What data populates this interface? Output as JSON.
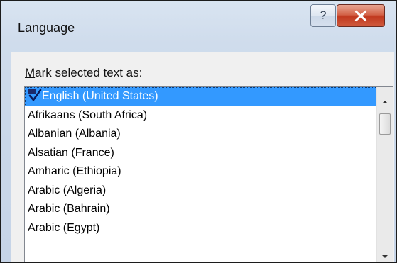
{
  "window": {
    "title": "Language",
    "help_glyph": "?",
    "help_icon": "help-icon",
    "close_icon": "close-icon",
    "close_color": "#c1391f"
  },
  "mark_label": {
    "accesskey": "M",
    "rest": "ark selected text as:"
  },
  "languages": {
    "selected_index": 0,
    "selected_icon": "spelling-abc-check-icon",
    "items": [
      "English (United States)",
      "Afrikaans (South Africa)",
      "Albanian (Albania)",
      "Alsatian (France)",
      "Amharic (Ethiopia)",
      "Arabic (Algeria)",
      "Arabic (Bahrain)",
      "Arabic (Egypt)"
    ],
    "selection_color": "#3399ff"
  },
  "scrollbar": {
    "up_icon": "scroll-up-arrow-icon",
    "down_icon": "scroll-down-arrow-icon"
  }
}
